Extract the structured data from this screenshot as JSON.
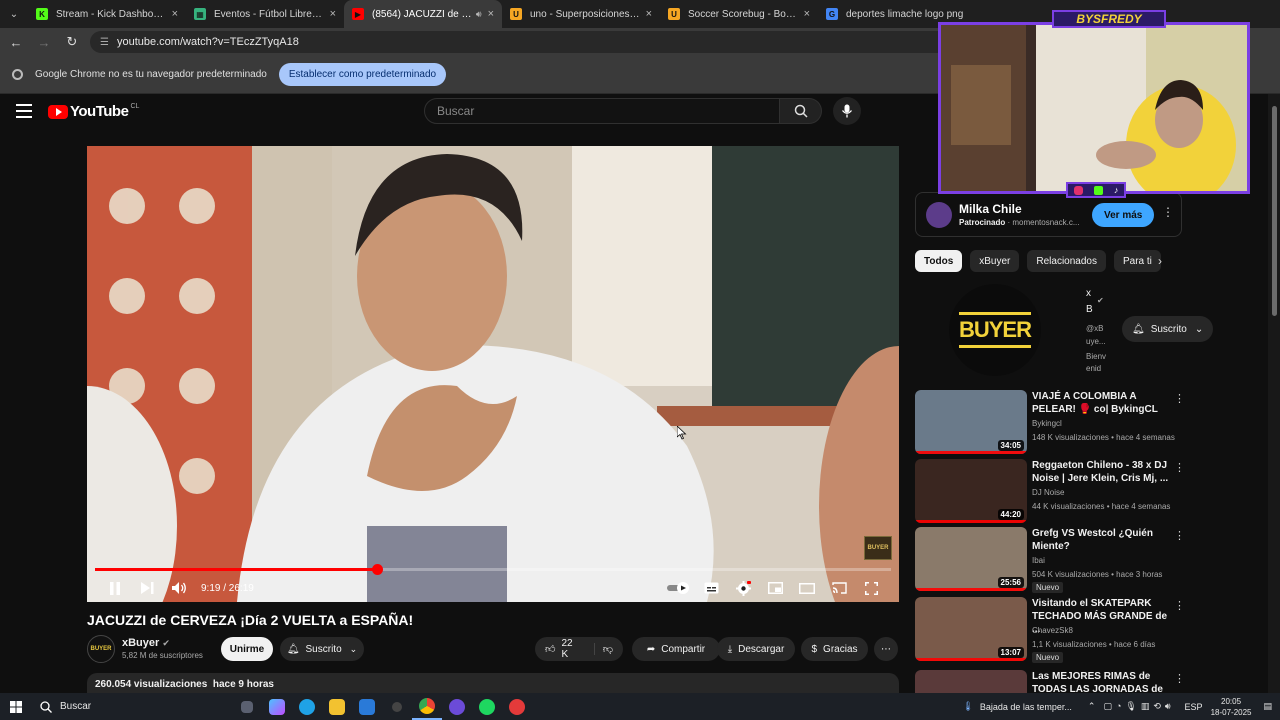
{
  "browser": {
    "tabs": [
      {
        "title": "Stream - Kick Dashboard",
        "fav": "K",
        "favColor": "#53fc18"
      },
      {
        "title": "Eventos - Fútbol Libre TV",
        "fav": "▦",
        "favColor": "#36b37e"
      },
      {
        "title": "(8564) JACUZZI de CERVEZA",
        "fav": "▶",
        "favColor": "#ff0000",
        "active": true
      },
      {
        "title": "uno - Superposiciones en vivo",
        "fav": "U",
        "favColor": "#f5a623"
      },
      {
        "title": "Soccer Scorebug - Bold - Aplicación",
        "fav": "U",
        "favColor": "#f5a623"
      },
      {
        "title": "deportes limache logo png",
        "fav": "G",
        "favColor": "#4285f4"
      }
    ],
    "url": "youtube.com/watch?v=TEczZTyqA18",
    "infobar": {
      "text": "Google Chrome no es tu navegador predeterminado",
      "button": "Establecer como predeterminado"
    }
  },
  "youtube": {
    "logo_region": "CL",
    "search_placeholder": "Buscar"
  },
  "player": {
    "time": "9:19 / 26:19",
    "progress_fraction": 0.354,
    "watermark": "BUYER"
  },
  "video": {
    "title": "JACUZZI de CERVEZA ¡Día 2 VUELTA a ESPAÑA!",
    "channel": "xBuyer",
    "channel_avatar_text": "BUYER",
    "subscribers": "5,82 M de suscriptores",
    "join": "Unirme",
    "subscribed": "Suscrito",
    "likes": "22 K",
    "share": "Compartir",
    "download": "Descargar",
    "thanks": "Gracias",
    "views_line": "260.054 visualizaciones  hace 9 horas"
  },
  "sponsor": {
    "name": "Milka Chile",
    "label": "Patrocinado",
    "domain": "momentosnack.c...",
    "button": "Ver más"
  },
  "chips": [
    "Todos",
    "xBuyer",
    "Relacionados",
    "Para ti"
  ],
  "channel_card": {
    "avatar_text": "BUYER",
    "name_line1": "x",
    "name_line2": "B",
    "handle_line1": "@xB",
    "handle_line2": "uye...",
    "desc_line1": "Bienv",
    "desc_line2": "enid",
    "subscribe": "Suscrito"
  },
  "recommendations": [
    {
      "title": "VIAJÉ A COLOMBIA A PELEAR! 🥊 co| BykingCL",
      "channel": "Bykingcl",
      "meta": "148 K visualizaciones • hace 4 semanas",
      "duration": "34:05",
      "badge": "",
      "thumbColor": "#6a7a8a"
    },
    {
      "title": "Reggaeton Chileno - 38 x DJ Noise | Jere Klein, Cris Mj, ...",
      "channel": "DJ Noise",
      "meta": "44 K visualizaciones • hace 4 semanas",
      "duration": "44:20",
      "badge": "",
      "thumbColor": "#3a2620"
    },
    {
      "title": "Grefg VS Westcol ¿Quién Miente?",
      "channel": "Ibai",
      "meta": "504 K visualizaciones • hace 3 horas",
      "duration": "25:56",
      "badge": "Nuevo",
      "thumbColor": "#8a7a6a"
    },
    {
      "title": "Visitando el SKATEPARK TECHADO MÁS GRANDE de ...",
      "channel": "ChavezSk8",
      "meta": "1,1 K visualizaciones • hace 6 días",
      "duration": "13:07",
      "badge": "Nuevo",
      "thumbColor": "#7a5a4a"
    },
    {
      "title": "Las MEJORES RIMAS de TODAS LAS JORNADAS de la FMS ...",
      "channel": "",
      "meta": "",
      "duration": "",
      "badge": "",
      "thumbColor": "#5a3a3a"
    }
  ],
  "overlay": {
    "title": "BYSFREDY"
  },
  "taskbar": {
    "search": "Buscar",
    "weather": "Bajada de las temper...",
    "lang": "ESP",
    "time": "20:05",
    "date": "18-07-2025"
  }
}
